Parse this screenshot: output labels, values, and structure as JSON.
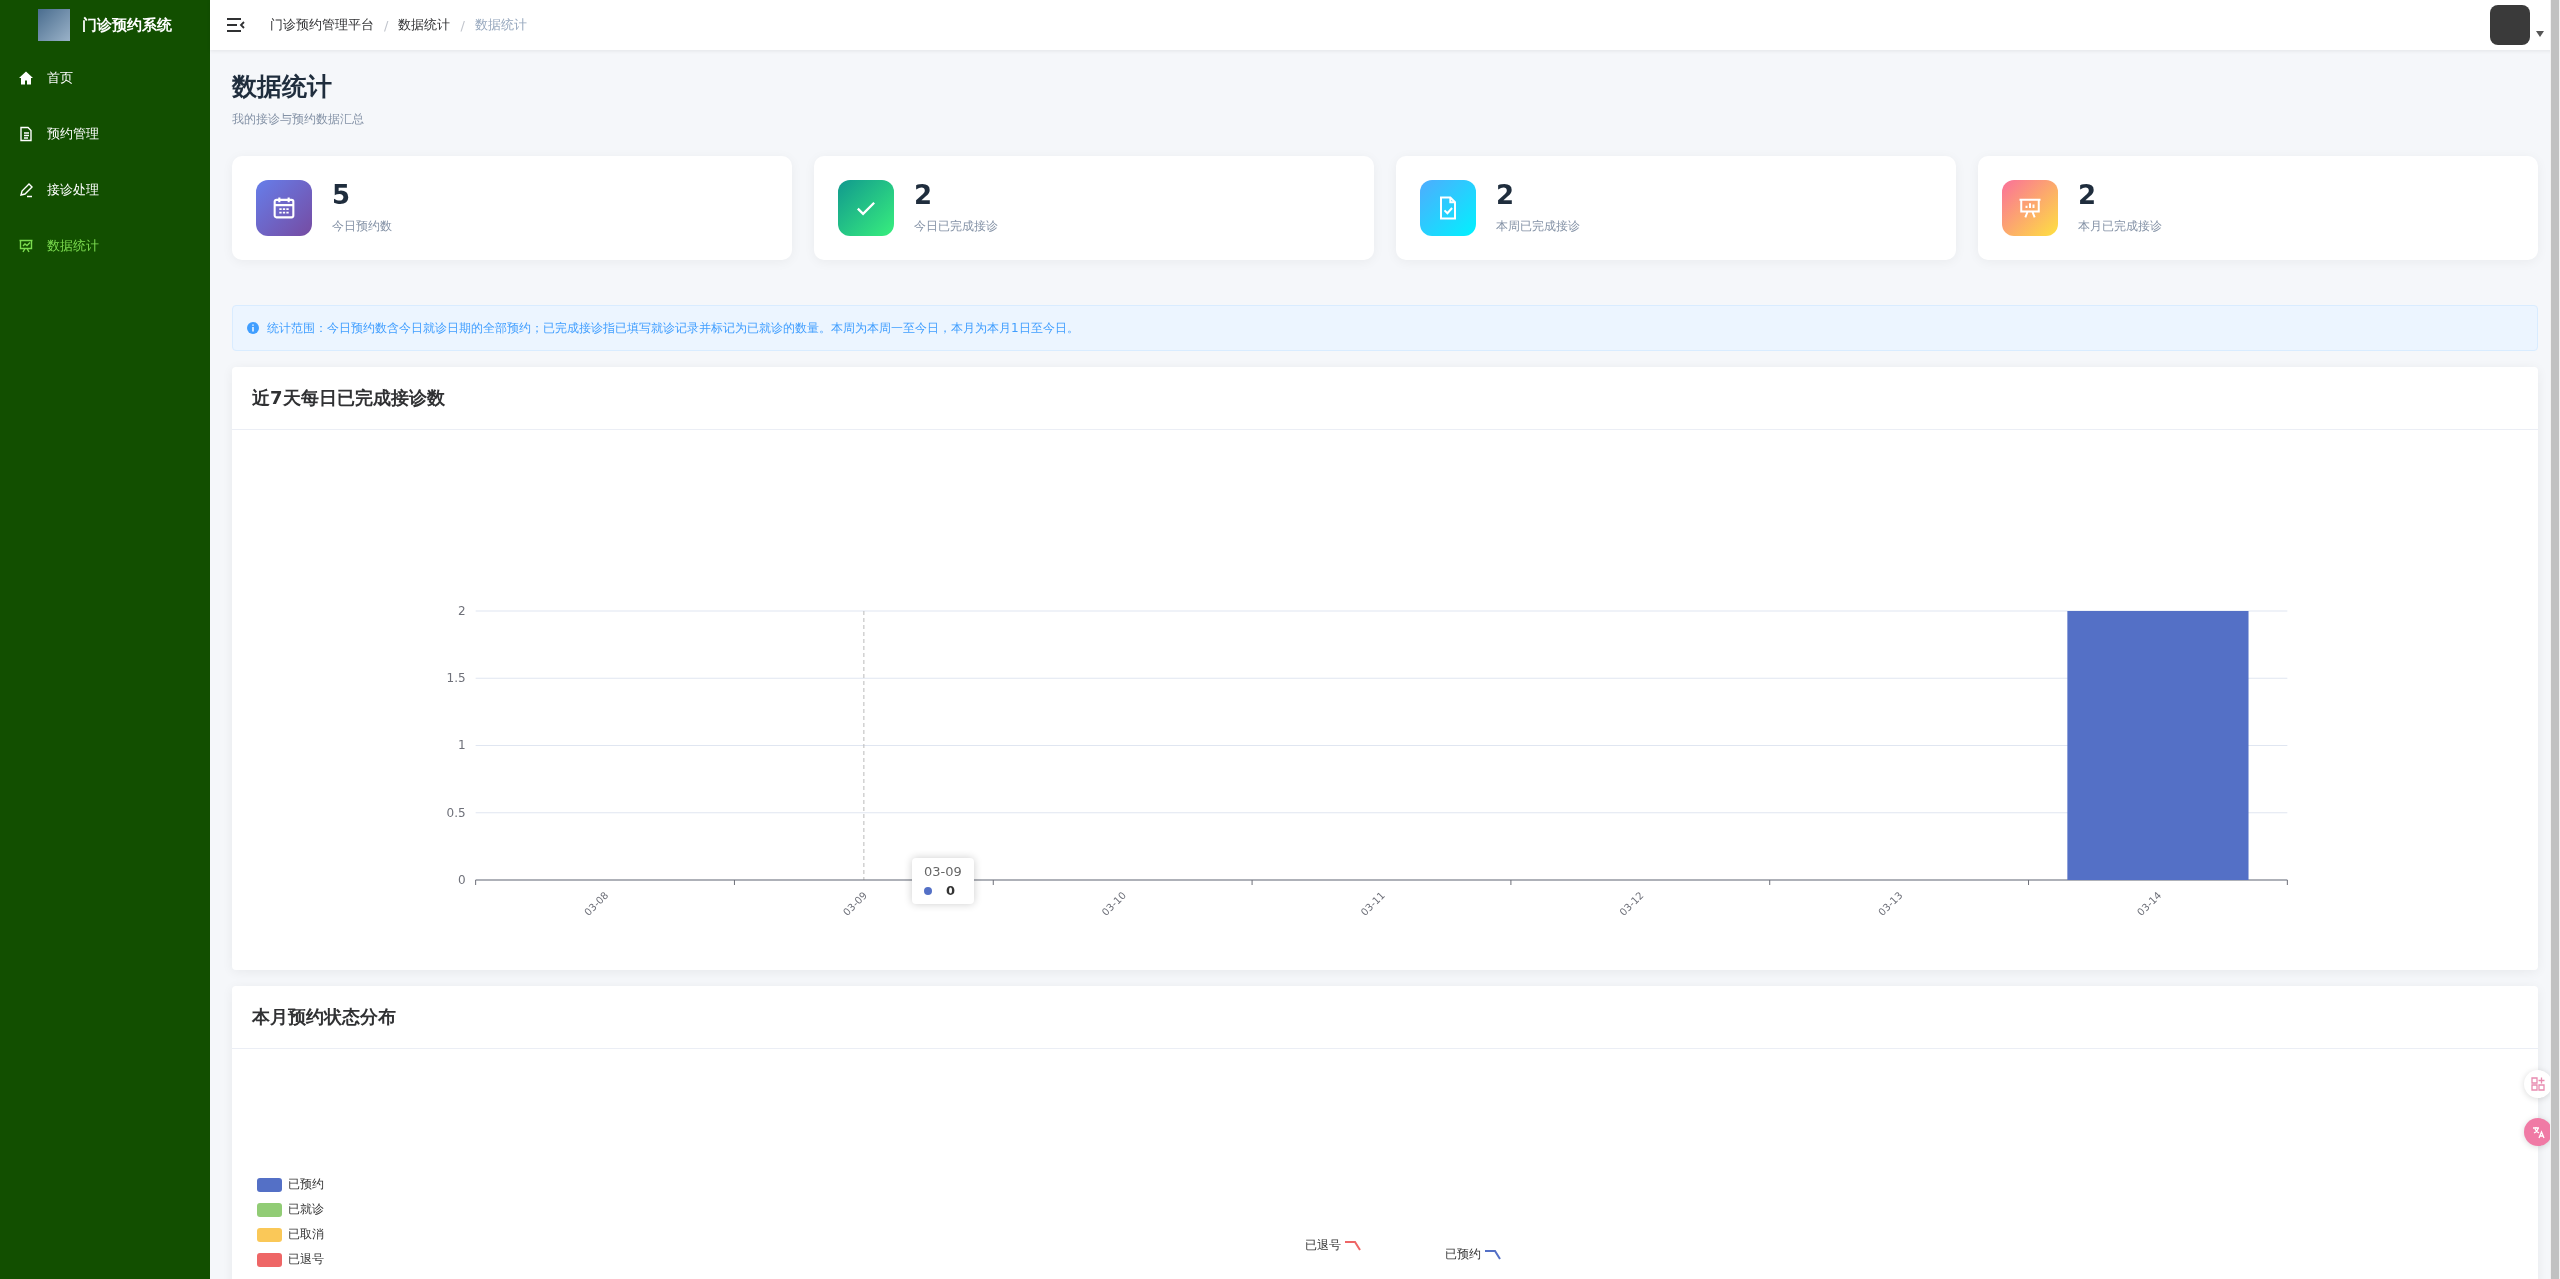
{
  "sidebar": {
    "title": "门诊预约系统",
    "items": [
      {
        "label": "首页",
        "kind": "home",
        "selected": false
      },
      {
        "label": "预约管理",
        "kind": "document",
        "selected": false
      },
      {
        "label": "接诊处理",
        "kind": "pen",
        "selected": false
      },
      {
        "label": "数据统计",
        "kind": "board",
        "selected": true
      }
    ]
  },
  "breadcrumb": {
    "separator": "/",
    "items": [
      "门诊预约管理平台",
      "数据统计",
      "数据统计"
    ]
  },
  "page": {
    "title": "数据统计",
    "subtitle": "我的接诊与预约数据汇总"
  },
  "stats": [
    {
      "value": "5",
      "label": "今日预约数",
      "kind": "calendar"
    },
    {
      "value": "2",
      "label": "今日已完成接诊",
      "kind": "check"
    },
    {
      "value": "2",
      "label": "本周已完成接诊",
      "kind": "file-check"
    },
    {
      "value": "2",
      "label": "本月已完成接诊",
      "kind": "board"
    }
  ],
  "notice": "统计范围：今日预约数含今日就诊日期的全部预约；已完成接诊指已填写就诊记录并标记为已就诊的数量。本周为本周一至今日，本月为本月1日至今日。",
  "daily_chart": {
    "title": "近7天每日已完成接诊数",
    "tooltip": {
      "title": "03-09",
      "value": "0"
    },
    "chart_data": {
      "type": "bar",
      "categories": [
        "03-08",
        "03-09",
        "03-10",
        "03-11",
        "03-12",
        "03-13",
        "03-14"
      ],
      "series": [
        {
          "color": "#5470c6",
          "values": [
            0,
            0,
            0,
            0,
            0,
            0,
            2
          ]
        }
      ],
      "ylim": [
        0,
        2
      ],
      "yticks": [
        0,
        0.5,
        1,
        1.5,
        2
      ],
      "grid": true,
      "ref_lines": [
        {
          "axis": "x",
          "value": "03-09"
        }
      ]
    }
  },
  "status_chart": {
    "title": "本月预约状态分布",
    "legend": [
      {
        "label": "已预约",
        "color": "#5470c6"
      },
      {
        "label": "已就诊",
        "color": "#91cc75"
      },
      {
        "label": "已取消",
        "color": "#fac858"
      },
      {
        "label": "已退号",
        "color": "#ee6666"
      }
    ],
    "slice_labels": [
      {
        "label": "已退号",
        "color": "#ee6666"
      },
      {
        "label": "已预约",
        "color": "#5470c6"
      }
    ]
  }
}
